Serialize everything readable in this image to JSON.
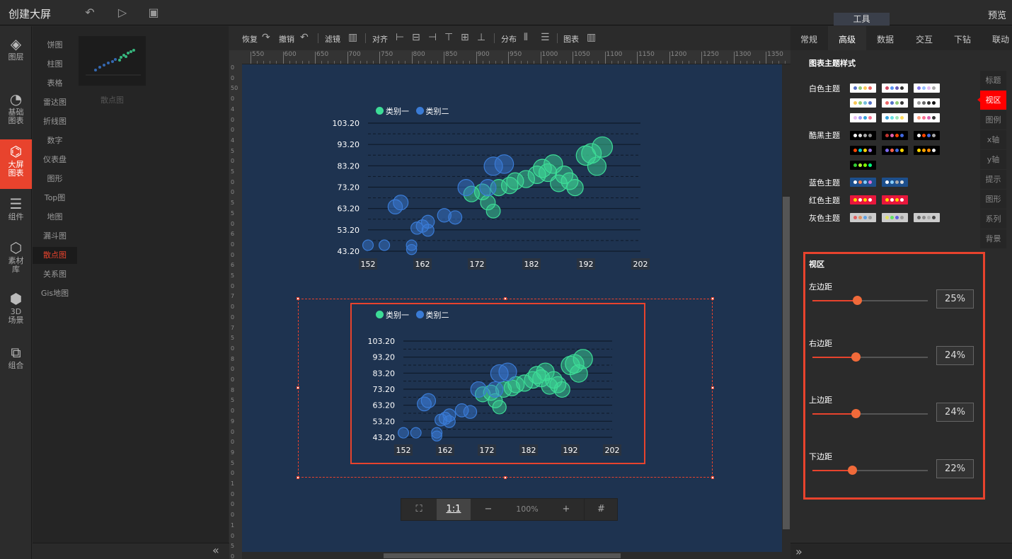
{
  "app": {
    "title": "创建大屏",
    "preview": "预览",
    "tool_tab": "工具"
  },
  "leftnav": [
    {
      "label": "图层",
      "icon": "layers-icon"
    },
    {
      "label": "基础图表",
      "icon": "pie-chart-icon"
    },
    {
      "label": "大屏图表",
      "icon": "screen-chart-icon"
    },
    {
      "label": "组件",
      "icon": "sliders-icon"
    },
    {
      "label": "素材库",
      "icon": "hexagons-icon"
    },
    {
      "label": "3D场景",
      "icon": "cube-icon"
    },
    {
      "label": "组合",
      "icon": "group-icon"
    }
  ],
  "subnav": [
    "饼图",
    "柱图",
    "表格",
    "雷达图",
    "折线图",
    "数字",
    "仪表盘",
    "图形",
    "Top图",
    "地图",
    "漏斗图",
    "散点图",
    "关系图",
    "Gis地图"
  ],
  "thumb_label": "散点图",
  "toolbar": {
    "restore": "恢复",
    "undo": "撤销",
    "filter": "滤镜",
    "align": "对齐",
    "distribute": "分布",
    "chart": "图表"
  },
  "ruler_h": [
    "550",
    "600",
    "650",
    "700",
    "750",
    "800",
    "850",
    "900",
    "950",
    "1000",
    "1050",
    "1100",
    "1150",
    "1200",
    "1250",
    "1300",
    "1350"
  ],
  "ruler_v": [
    "0",
    "0",
    "50",
    "0",
    "4",
    "0",
    "0",
    "4",
    "5",
    "0",
    "5",
    "0",
    "0",
    "5",
    "5",
    "0",
    "6",
    "0",
    "0",
    "6",
    "5",
    "0",
    "7",
    "0",
    "0",
    "7",
    "5",
    "0",
    "8",
    "0",
    "0",
    "8",
    "5",
    "0",
    "9",
    "0",
    "0",
    "9",
    "5",
    "0",
    "1",
    "0",
    "0",
    "0",
    "1",
    "0",
    "5",
    "0"
  ],
  "zoom": {
    "fit_icon": "fit-icon",
    "one_to_one": "1:1",
    "minus": "−",
    "value": "100%",
    "plus": "+",
    "grid_icon": "grid-icon"
  },
  "right_tabs": [
    "常规",
    "高级",
    "数据",
    "交互",
    "下钻",
    "联动"
  ],
  "theme_section_title": "图表主题样式",
  "themes": [
    {
      "label": "白色主题"
    },
    {
      "label": "酷黑主题"
    },
    {
      "label": "蓝色主题"
    },
    {
      "label": "红色主题"
    },
    {
      "label": "灰色主题"
    }
  ],
  "side_tabs": [
    "标题",
    "视区",
    "图例",
    "x轴",
    "y轴",
    "提示",
    "图形",
    "系列",
    "背景"
  ],
  "viewport": {
    "title": "视区",
    "sliders": [
      {
        "label": "左边距",
        "value": "25%",
        "fraction": 0.25
      },
      {
        "label": "右边距",
        "value": "24%",
        "fraction": 0.24
      },
      {
        "label": "上边距",
        "value": "24%",
        "fraction": 0.24
      },
      {
        "label": "下边距",
        "value": "22%",
        "fraction": 0.22
      }
    ]
  },
  "chart_data": [
    {
      "type": "scatter",
      "legend": [
        "类别一",
        "类别二"
      ],
      "colors": {
        "类别一": "#3ddc97",
        "类别二": "#3a7bd5"
      },
      "ylim": [
        43.2,
        103.2
      ],
      "yticks": [
        "103.20",
        "93.20",
        "83.20",
        "73.20",
        "63.20",
        "53.20",
        "43.20"
      ],
      "xlim": [
        152,
        202
      ],
      "xticks": [
        "152",
        "162",
        "172",
        "182",
        "192",
        "202"
      ],
      "series": [
        {
          "name": "类别一",
          "points": [
            [
              171,
              70
            ],
            [
              173,
              71
            ],
            [
              174,
              66
            ],
            [
              175,
              62
            ],
            [
              176,
              73
            ],
            [
              178,
              74
            ],
            [
              179,
              76
            ],
            [
              181,
              77
            ],
            [
              183,
              79
            ],
            [
              184,
              82
            ],
            [
              185,
              80
            ],
            [
              186,
              84
            ],
            [
              187,
              75
            ],
            [
              188,
              79
            ],
            [
              189,
              76
            ],
            [
              190,
              73
            ],
            [
              192,
              88
            ],
            [
              193,
              89
            ],
            [
              194,
              83
            ],
            [
              195,
              92
            ]
          ]
        },
        {
          "name": "类别二",
          "points": [
            [
              152,
              46
            ],
            [
              155,
              46
            ],
            [
              157,
              64
            ],
            [
              158,
              66
            ],
            [
              160,
              46
            ],
            [
              160,
              44
            ],
            [
              161,
              54
            ],
            [
              162,
              55
            ],
            [
              163,
              57
            ],
            [
              163,
              53
            ],
            [
              166,
              60
            ],
            [
              168,
              59
            ],
            [
              170,
              73
            ],
            [
              175,
              83
            ],
            [
              177,
              84
            ],
            [
              174,
              73
            ]
          ]
        }
      ]
    },
    {
      "type": "scatter",
      "legend": [
        "类别一",
        "类别二"
      ],
      "colors": {
        "类别一": "#3ddc97",
        "类别二": "#3a7bd5"
      },
      "ylim": [
        43.2,
        103.2
      ],
      "yticks": [
        "103.20",
        "93.20",
        "83.20",
        "73.20",
        "63.20",
        "53.20",
        "43.20"
      ],
      "xlim": [
        152,
        202
      ],
      "xticks": [
        "152",
        "162",
        "172",
        "182",
        "192",
        "202"
      ],
      "series": [
        {
          "name": "类别一",
          "points": [
            [
              171,
              70
            ],
            [
              173,
              71
            ],
            [
              174,
              66
            ],
            [
              175,
              62
            ],
            [
              176,
              73
            ],
            [
              178,
              74
            ],
            [
              179,
              76
            ],
            [
              181,
              77
            ],
            [
              183,
              79
            ],
            [
              184,
              82
            ],
            [
              185,
              80
            ],
            [
              186,
              84
            ],
            [
              187,
              75
            ],
            [
              188,
              79
            ],
            [
              189,
              76
            ],
            [
              190,
              73
            ],
            [
              192,
              88
            ],
            [
              193,
              89
            ],
            [
              194,
              83
            ],
            [
              195,
              92
            ]
          ]
        },
        {
          "name": "类别二",
          "points": [
            [
              152,
              46
            ],
            [
              155,
              46
            ],
            [
              157,
              64
            ],
            [
              158,
              66
            ],
            [
              160,
              46
            ],
            [
              160,
              44
            ],
            [
              161,
              54
            ],
            [
              162,
              55
            ],
            [
              163,
              57
            ],
            [
              163,
              53
            ],
            [
              166,
              60
            ],
            [
              168,
              59
            ],
            [
              170,
              73
            ],
            [
              175,
              83
            ],
            [
              177,
              84
            ],
            [
              174,
              73
            ]
          ]
        }
      ]
    }
  ]
}
